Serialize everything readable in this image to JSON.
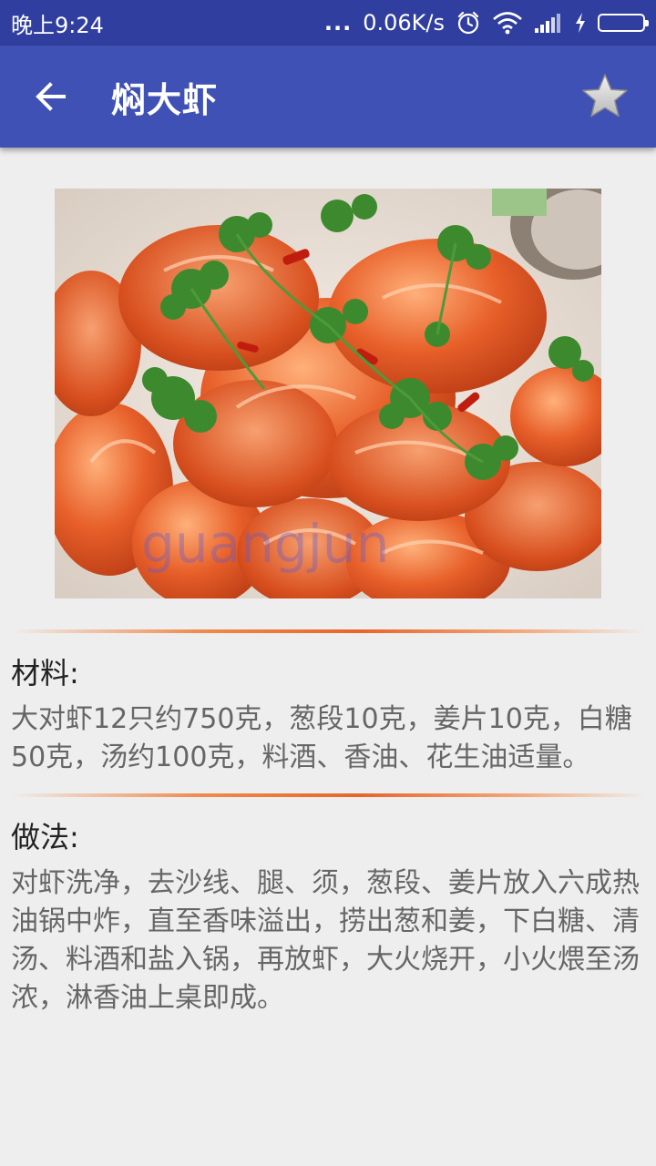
{
  "status_bar": {
    "time": "晚上9:24",
    "network_speed": "0.06K/s",
    "dots": "...",
    "icons": [
      "alarm-icon",
      "wifi-icon",
      "signal-icon",
      "charging-icon",
      "battery-icon"
    ]
  },
  "app_bar": {
    "title": "焖大虾",
    "back_icon": "arrow-left-icon",
    "favorite_icon": "star-icon"
  },
  "recipe": {
    "image_description": "shrimp-dish-photo",
    "ingredients_label": "材料:",
    "ingredients": "大对虾12只约750克，葱段10克，姜片10克，白糖50克，汤约100克，料酒、香油、花生油适量。",
    "method_label": "做法:",
    "method": "对虾洗净，去沙线、腿、须，葱段、姜片放入六成热油锅中炸，直至香味溢出，捞出葱和姜，下白糖、清汤、料酒和盐入锅，再放虾，大火烧开，小火煨至汤浓，淋香油上桌即成。"
  },
  "colors": {
    "status_bar": "#303f9f",
    "app_bar": "#3f51b5",
    "background": "#eeeeee",
    "divider_accent": "#e8652a"
  }
}
